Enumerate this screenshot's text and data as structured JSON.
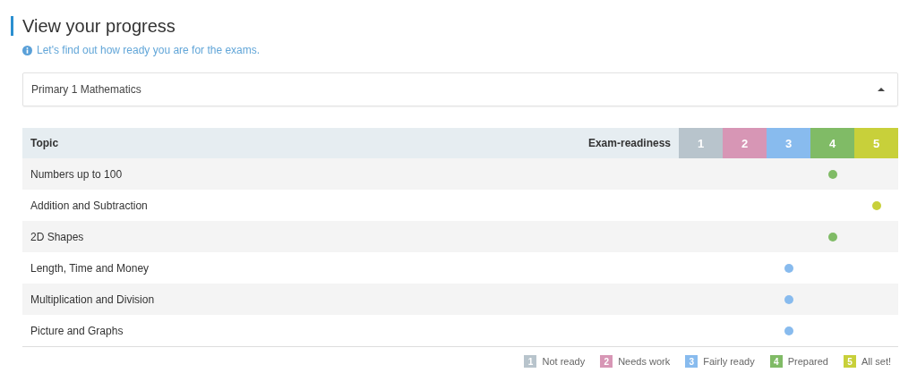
{
  "title": "View your progress",
  "info": "Let's find out how ready you are for the exams.",
  "subject_select": {
    "value": "Primary 1 Mathematics"
  },
  "table": {
    "columns": [
      "Topic",
      "Exam-readiness"
    ],
    "levels": [
      {
        "label": "1",
        "color": "#b8c4cc"
      },
      {
        "label": "2",
        "color": "#d796b5"
      },
      {
        "label": "3",
        "color": "#88bbee"
      },
      {
        "label": "4",
        "color": "#80bb66"
      },
      {
        "label": "5",
        "color": "#c8d03a"
      }
    ],
    "rows": [
      {
        "topic": "Numbers up to 100",
        "marks": [
          false,
          false,
          false,
          true,
          false
        ]
      },
      {
        "topic": "Addition and Subtraction",
        "marks": [
          false,
          false,
          false,
          false,
          true
        ]
      },
      {
        "topic": "2D Shapes",
        "marks": [
          false,
          false,
          false,
          true,
          false
        ]
      },
      {
        "topic": "Length, Time and Money",
        "marks": [
          false,
          false,
          true,
          false,
          false
        ]
      },
      {
        "topic": "Multiplication and Division",
        "marks": [
          false,
          false,
          true,
          false,
          false
        ]
      },
      {
        "topic": "Picture and Graphs",
        "marks": [
          false,
          false,
          true,
          false,
          false
        ]
      }
    ]
  },
  "legend": [
    {
      "label": "1",
      "name": "Not ready",
      "color": "#b8c4cc"
    },
    {
      "label": "2",
      "name": "Needs work",
      "color": "#d796b5"
    },
    {
      "label": "3",
      "name": "Fairly ready",
      "color": "#88bbee"
    },
    {
      "label": "4",
      "name": "Prepared",
      "color": "#80bb66"
    },
    {
      "label": "5",
      "name": "All set!",
      "color": "#c8d03a"
    }
  ]
}
